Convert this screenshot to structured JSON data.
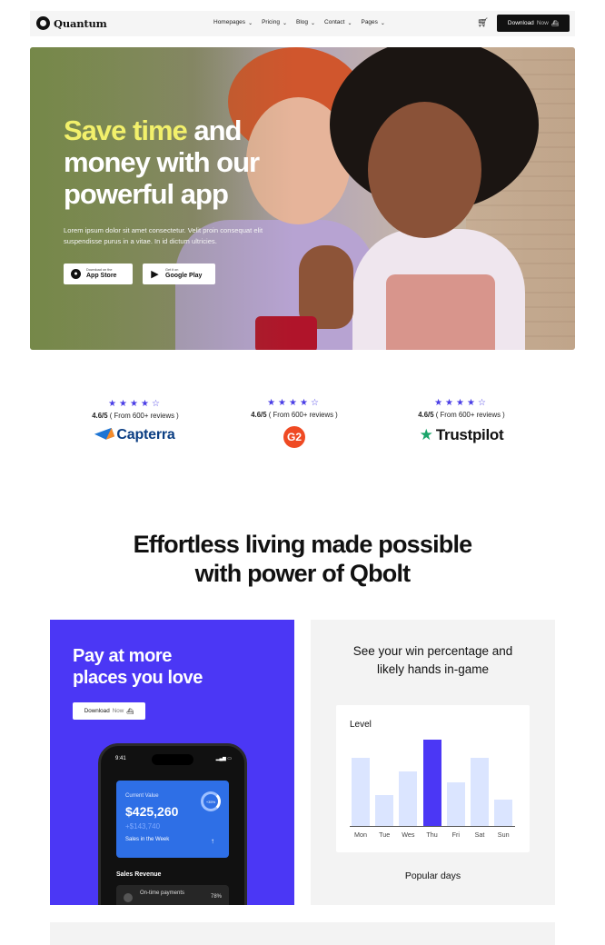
{
  "nav": {
    "logo": "Quantum",
    "menu": [
      "Homepages",
      "Pricing",
      "Blog",
      "Contact",
      "Pages"
    ],
    "cta_label": "Download",
    "cta_label_muted": "Now"
  },
  "hero": {
    "title_highlight": "Save time",
    "title_rest_1": " and",
    "title_rest_2": "money with our",
    "title_rest_3": "powerful app",
    "subtitle": "Lorem ipsum dolor sit amet consectetur. Velit proin consequat elit suspendisse purus in a vitae. In id dictum ultricies.",
    "app_store_small": "Download on the",
    "app_store_big": "App Store",
    "google_play_small": "Get it on",
    "google_play_big": "Google Play"
  },
  "ratings": [
    {
      "score": "4.6/5",
      "reviews": "( From 600+ reviews )",
      "brand": "Capterra"
    },
    {
      "score": "4.6/5",
      "reviews": "( From 600+ reviews )",
      "brand": "G2"
    },
    {
      "score": "4.6/5",
      "reviews": "( From 600+ reviews )",
      "brand": "Trustpilot"
    }
  ],
  "section": {
    "title_line1": "Effortless living made possible",
    "title_line2": "with power of Qbolt"
  },
  "card_pay": {
    "title_line1": "Pay at more",
    "title_line2": "places you love",
    "btn_label": "Download",
    "btn_label_muted": "Now",
    "phone": {
      "time": "9:41",
      "current_value_label": "Current Value",
      "current_value": "$425,260",
      "delta": "+$143,740",
      "sales_week": "Sales in the Week",
      "ring": "+35%",
      "sales_revenue": "Sales Revenue",
      "otp_name": "On-time payments",
      "otp_pct": "78%"
    }
  },
  "card_stats": {
    "title_line1": "See your win percentage and",
    "title_line2": "likely hands in-game",
    "chart_label": "Level",
    "footer": "Popular days"
  },
  "chart_data": {
    "type": "bar",
    "categories": [
      "Mon",
      "Tue",
      "Wes",
      "Thu",
      "Fri",
      "Sat",
      "Sun"
    ],
    "values": [
      68,
      31,
      55,
      86,
      44,
      68,
      26
    ],
    "highlight": "Thu",
    "ylim": [
      0,
      100
    ],
    "colors": {
      "bar": "#dbe5ff",
      "highlight": "#4b37f5"
    }
  },
  "colors": {
    "accent": "#4b37f5",
    "highlight_text": "#f2f06b",
    "star": "#4a3ee6"
  }
}
